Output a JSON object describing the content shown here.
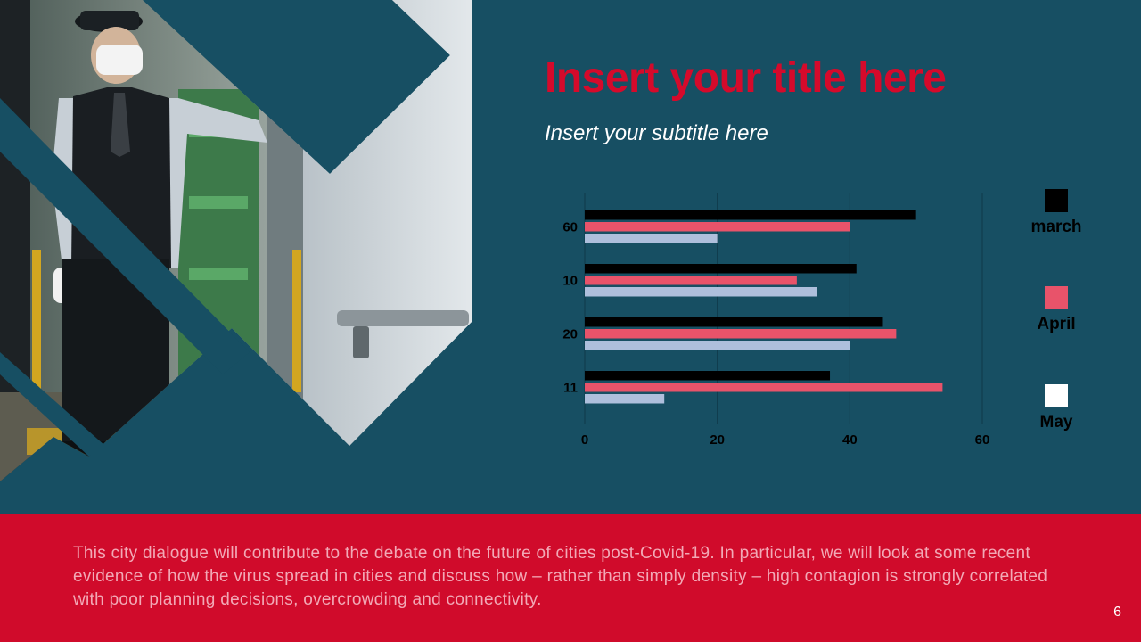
{
  "slide": {
    "title": "Insert your title here",
    "subtitle": "Insert your subtitle here",
    "body_text": "This city dialogue will contribute to the debate on the future of cities post-Covid-19. In particular, we will look at some recent evidence of how the virus spread in cities and discuss how – rather than simply density – high contagion is strongly correlated with poor planning decisions, overcrowding and connectivity.",
    "page_number": "6",
    "photo_icon": "station-conductor-photo",
    "colors": {
      "background": "#174f63",
      "title": "#d50a2b",
      "footer": "#d00b2b",
      "footer_text": "#f2a9b6"
    }
  },
  "chart_data": {
    "type": "bar",
    "orientation": "horizontal",
    "categories": [
      "60",
      "10",
      "20",
      "11"
    ],
    "series": [
      {
        "name": "march",
        "color": "#000000",
        "values": [
          50,
          41,
          45,
          37
        ]
      },
      {
        "name": "April",
        "color": "#e8536a",
        "values": [
          40,
          32,
          47,
          54
        ]
      },
      {
        "name": "May",
        "color": "#aebfdc",
        "values": [
          20,
          35,
          40,
          12
        ]
      }
    ],
    "xlim": [
      0,
      60
    ],
    "xticks": [
      "0",
      "20",
      "40",
      "60"
    ],
    "grid": true,
    "legend_position": "right",
    "legend_colors": [
      "#000000",
      "#e8536a",
      "#ffffff"
    ]
  }
}
